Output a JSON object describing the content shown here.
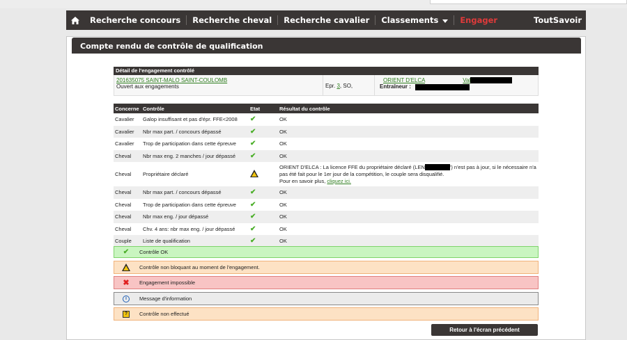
{
  "nav": {
    "home_icon": "home-icon",
    "items": [
      "Recherche concours",
      "Recherche cheval",
      "Recherche cavalier",
      "Classements",
      "Engager"
    ],
    "right": "ToutSavoir"
  },
  "panel": {
    "title": "Compte rendu de contrôle de qualification"
  },
  "detail": {
    "header": "Détail de l'engagement contrôlé",
    "concours_link": "201635075 SAINT-MALO SAINT-COULOMB",
    "status": "Ouvert aux engagements",
    "epreuve_prefix": "Epr.",
    "epreuve_num": "3",
    "epreuve_suffix": ", SO,",
    "horse_link": "ORIENT D'ELCA",
    "rider_link": "Val",
    "trainer_label": "Entraîneur :"
  },
  "table": {
    "headers": [
      "Concerne",
      "Contrôle",
      "Etat",
      "Résultat du contrôle"
    ],
    "rows": [
      {
        "concerne": "Cavalier",
        "controle": "Galop insuffisant et pas d'épr. FFE<2008",
        "etat": "ok",
        "resultat": "OK"
      },
      {
        "concerne": "Cavalier",
        "controle": "Nbr max part. / concours dépassé",
        "etat": "ok",
        "resultat": "OK"
      },
      {
        "concerne": "Cavalier",
        "controle": "Trop de participation dans cette épreuve",
        "etat": "ok",
        "resultat": "OK"
      },
      {
        "concerne": "Cheval",
        "controle": "Nbr max eng. 2 manches / jour dépassé",
        "etat": "ok",
        "resultat": "OK"
      },
      {
        "concerne": "Cheval",
        "controle": "Propriétaire déclaré",
        "etat": "warn",
        "resultat_a": "ORIENT D'ELCA : La licence FFE du propriétaire déclaré (LEN",
        "resultat_b": "') n'est pas à jour, si le nécessaire n'a pas été fait pour le 1er jour de la compétition, le couple sera disqualifié.",
        "resultat_c": "Pour en savoir plus,",
        "resultat_link": "cliquez ici."
      },
      {
        "concerne": "Cheval",
        "controle": "Nbr max part. / concours dépassé",
        "etat": "ok",
        "resultat": "OK"
      },
      {
        "concerne": "Cheval",
        "controle": "Trop de participation dans cette épreuve",
        "etat": "ok",
        "resultat": "OK"
      },
      {
        "concerne": "Cheval",
        "controle": "Nbr max eng. / jour dépassé",
        "etat": "ok",
        "resultat": "OK"
      },
      {
        "concerne": "Cheval",
        "controle": "Chv. 4 ans: nbr max eng. / jour dépassé",
        "etat": "ok",
        "resultat": "OK"
      },
      {
        "concerne": "Couple",
        "controle": "Liste de qualification",
        "etat": "ok",
        "resultat": "OK"
      }
    ]
  },
  "legend": {
    "ok": "Contrôle OK",
    "warn": "Contrôle non bloquant au moment de l'engagement.",
    "err": "Engagement impossible",
    "info": "Message d'information",
    "ne": "Contrôle non effectué"
  },
  "back_button": "Retour à l'écran précédent",
  "colors": {
    "navbar": "#3a3635",
    "link": "#2e7d1e",
    "engager": "#e03a3a",
    "ok_green": "#4caf2a"
  }
}
